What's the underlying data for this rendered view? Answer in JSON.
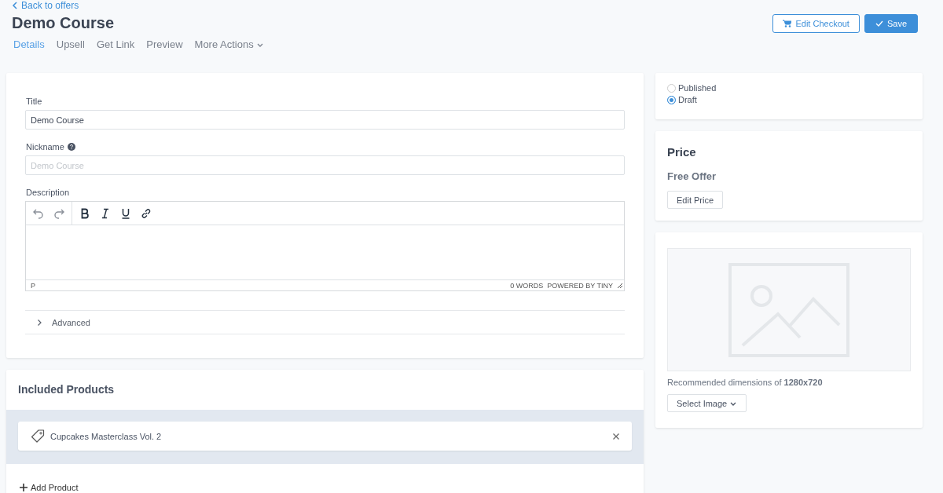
{
  "back_link": "Back to offers",
  "title": "Demo Course",
  "tabs": [
    {
      "label": "Details",
      "selected": true
    },
    {
      "label": "Upsell",
      "selected": false
    },
    {
      "label": "Get Link",
      "selected": false
    },
    {
      "label": "Preview",
      "selected": false
    },
    {
      "label": "More Actions",
      "selected": false,
      "kind": "dropdown"
    }
  ],
  "header_buttons": [
    {
      "label": "Edit Checkout",
      "kind": "outline"
    },
    {
      "label": "Save",
      "kind": "primary"
    }
  ],
  "form": {
    "title": {
      "label": "Title",
      "value": "Demo Course"
    },
    "nickname": {
      "label": "Nickname",
      "placeholder": "Demo Course"
    },
    "description": {
      "label": "Description",
      "status_path": "P",
      "word_count": "0 WORDS",
      "branding": "POWERED BY TINY"
    },
    "advanced": {
      "label": "Advanced",
      "expanded": false
    }
  },
  "included_products": {
    "heading": "Included Products",
    "items": [
      {
        "name": "Cupcakes Masterclass Vol. 2"
      }
    ],
    "add_label": "Add Product"
  },
  "status_options": [
    {
      "label": "Published",
      "selected": false
    },
    {
      "label": "Draft",
      "selected": true
    }
  ],
  "price": {
    "heading": "Price",
    "value": "Free Offer",
    "button": "Edit Price"
  },
  "image": {
    "hint": "Recommended dimensions of **1280x720**",
    "button": "Select Image"
  }
}
